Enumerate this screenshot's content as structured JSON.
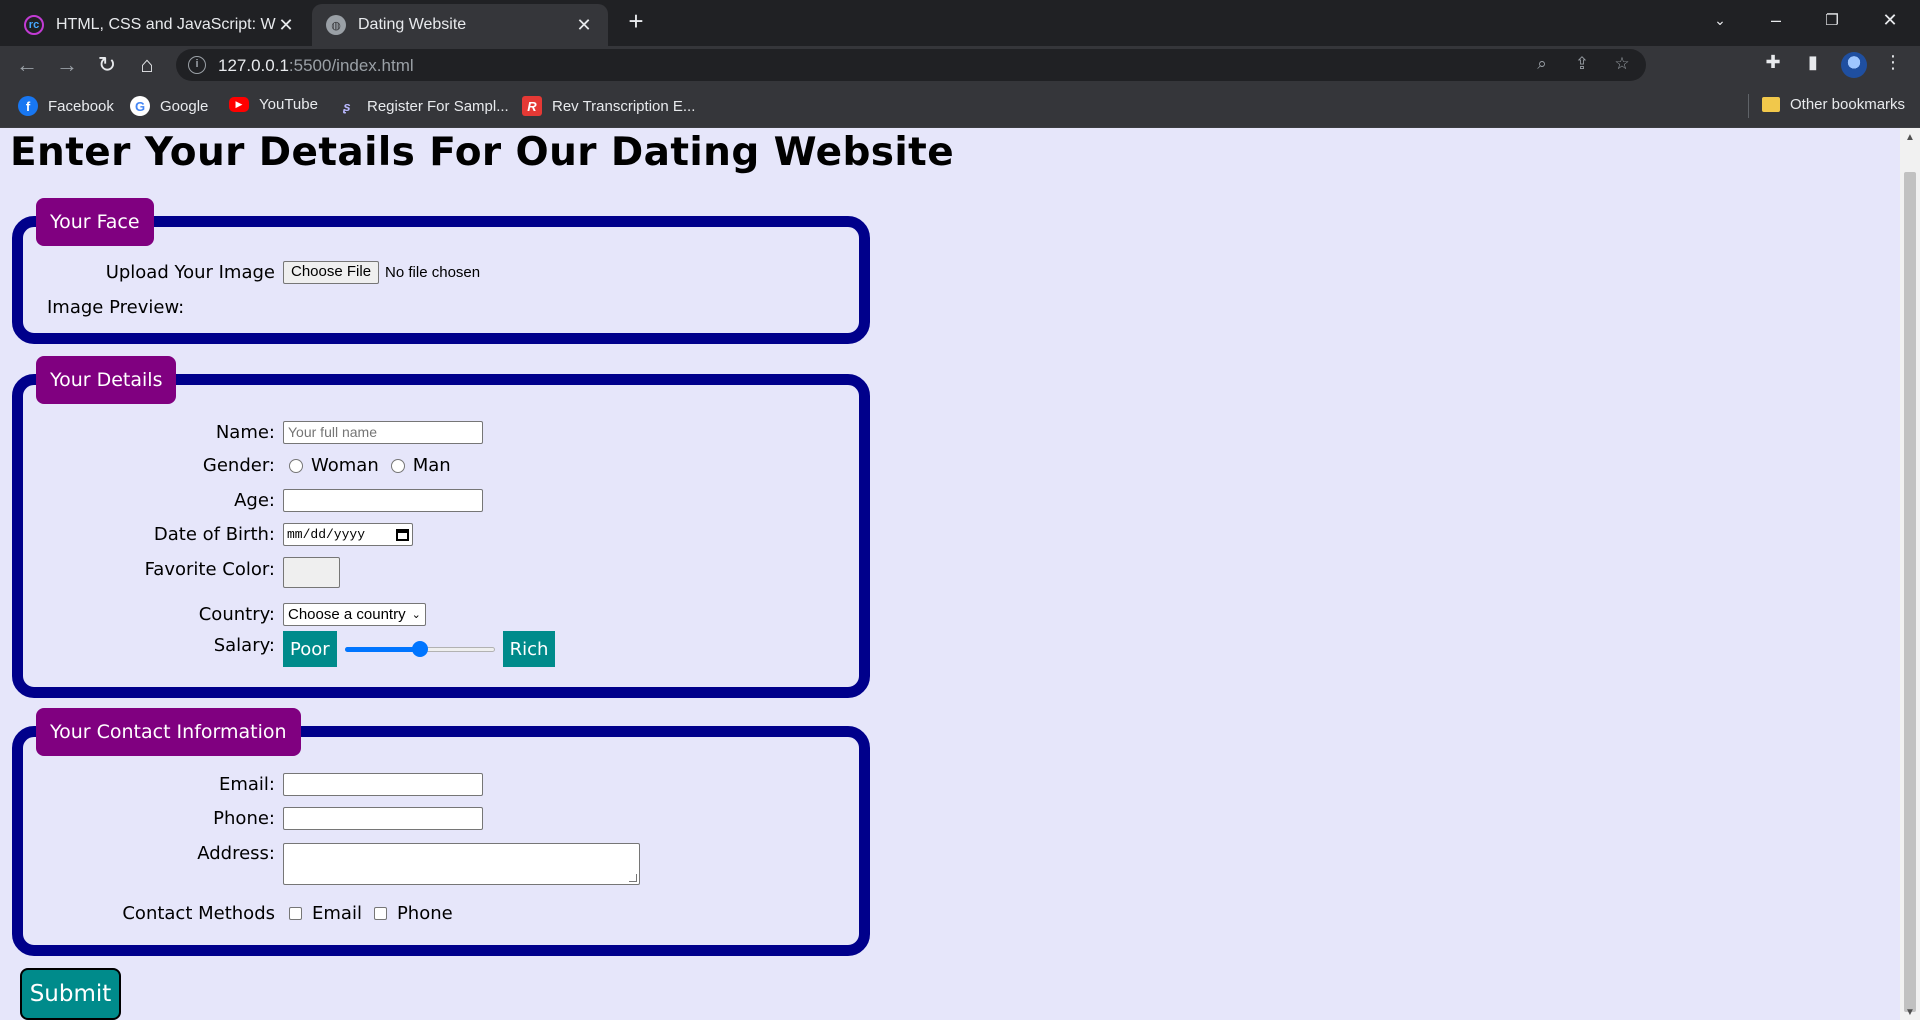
{
  "browser": {
    "tabs": [
      {
        "title": "HTML, CSS and JavaScript: Week",
        "favicon": "rc"
      },
      {
        "title": "Dating Website",
        "favicon": "globe"
      }
    ],
    "new_tab": "+",
    "url_host": "127.0.0.1",
    "url_rest": ":5500/index.html",
    "bookmarks": [
      {
        "label": "Facebook",
        "icon": "facebook-icon"
      },
      {
        "label": "Google",
        "icon": "google-icon"
      },
      {
        "label": "YouTube",
        "icon": "youtube-icon"
      },
      {
        "label": "Register For Sampl...",
        "icon": "register-icon"
      },
      {
        "label": "Rev Transcription E...",
        "icon": "rev-icon"
      }
    ],
    "other_bookmarks": "Other bookmarks"
  },
  "page": {
    "heading": "Enter Your Details For Our Dating Website",
    "face": {
      "legend": "Your Face",
      "upload_label": "Upload Your Image",
      "file_button": "Choose File",
      "file_status": "No file chosen",
      "preview_label": "Image Preview:"
    },
    "details": {
      "legend": "Your Details",
      "name_label": "Name:",
      "name_placeholder": "Your full name",
      "gender_label": "Gender:",
      "gender_options": [
        "Woman",
        "Man"
      ],
      "age_label": "Age:",
      "dob_label": "Date of Birth:",
      "dob_placeholder": "mm/dd/yyyy",
      "color_label": "Favorite Color:",
      "color_value": "#000000",
      "country_label": "Country:",
      "country_selected": "Choose a country",
      "salary_label": "Salary:",
      "salary_min_label": "Poor",
      "salary_max_label": "Rich",
      "salary_level": 0.5
    },
    "contact": {
      "legend": "Your Contact Information",
      "email_label": "Email:",
      "phone_label": "Phone:",
      "address_label": "Address:",
      "methods_label": "Contact Methods",
      "method_options": [
        "Email",
        "Phone"
      ]
    },
    "submit": "Submit"
  },
  "colors": {
    "page_background": "#e6e6fa",
    "fieldset_border": "#00008b",
    "legend_background": "#800080",
    "accent_teal": "#008b8b",
    "slider_blue": "#0075ff"
  }
}
